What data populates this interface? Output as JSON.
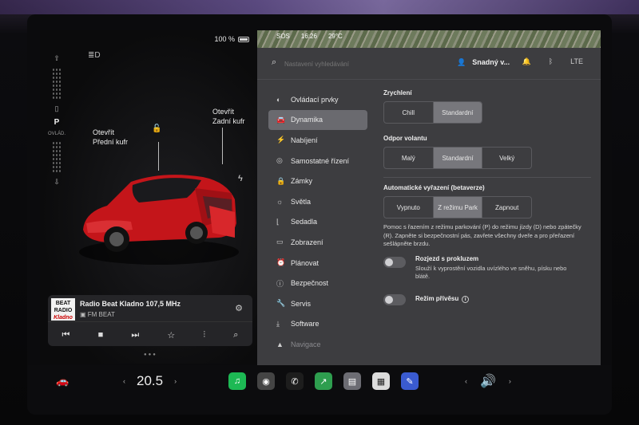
{
  "status": {
    "battery": "100 %",
    "time": "16:26",
    "temp": "29°C",
    "sos": "SOS"
  },
  "car": {
    "gear_p": "P",
    "gear_sub": "OVLÁD.",
    "front_trunk_line1": "Otevřít",
    "front_trunk_line2": "Přední kufr",
    "rear_trunk_line1": "Otevřít",
    "rear_trunk_line2": "Zadní kufr",
    "body_color": "#d0171b"
  },
  "media": {
    "logo_line1": "BEAT",
    "logo_line2": "RADIO",
    "logo_line3": "Kladno",
    "station": "Radio Beat Kladno 107,5 MHz",
    "source": "FM BEAT"
  },
  "search": {
    "placeholder": "Nastavení vyhledávání"
  },
  "profile": {
    "name": "Snadný v..."
  },
  "network": "LTE",
  "menu": [
    {
      "icon": "toggle-icon",
      "glyph": "◐",
      "label": "Ovládací prvky"
    },
    {
      "icon": "car-icon",
      "glyph": "🚘",
      "label": "Dynamika",
      "active": true
    },
    {
      "icon": "charging-icon",
      "glyph": "⚡",
      "label": "Nabíjení"
    },
    {
      "icon": "steering-wheel-icon",
      "glyph": "◎",
      "label": "Samostatné řízení"
    },
    {
      "icon": "lock-icon",
      "glyph": "🔒",
      "label": "Zámky"
    },
    {
      "icon": "light-icon",
      "glyph": "☼",
      "label": "Světla"
    },
    {
      "icon": "seat-icon",
      "glyph": "⌊",
      "label": "Sedadla"
    },
    {
      "icon": "display-icon",
      "glyph": "▭",
      "label": "Zobrazení"
    },
    {
      "icon": "alarm-clock-icon",
      "glyph": "⏰",
      "label": "Plánovat"
    },
    {
      "icon": "safety-icon",
      "glyph": "ⓘ",
      "label": "Bezpečnost"
    },
    {
      "icon": "wrench-icon",
      "glyph": "🔧",
      "label": "Servis"
    },
    {
      "icon": "download-icon",
      "glyph": "⤓",
      "label": "Software"
    },
    {
      "icon": "navigation-icon",
      "glyph": "▲",
      "label": "Navigace",
      "faded": true
    }
  ],
  "settings": {
    "acceleration": {
      "title": "Zrychlení",
      "options": [
        "Chill",
        "Standardní"
      ],
      "selected": 1
    },
    "steering": {
      "title": "Odpor volantu",
      "options": [
        "Malý",
        "Standardní",
        "Velký"
      ],
      "selected": 1
    },
    "auto_park": {
      "title": "Automatické vyřazení (betaverze)",
      "options": [
        "Vypnuto",
        "Z režimu Park",
        "Zapnout"
      ],
      "selected": 1,
      "description": "Pomoc s řazením z režimu parkování (P) do režimu jízdy (D) nebo zpátečky (R). Zapněte si bezpečnostní pás, zavřete všechny dveře a pro přeřazení sešlápněte brzdu."
    },
    "slip_start": {
      "title": "Rozjezd s prokluzem",
      "description": "Slouží k vyprostění vozidla uvízlého ve sněhu, písku nebo blátě.",
      "on": false
    },
    "trailer_mode": {
      "title": "Režim přívěsu",
      "on": false
    }
  },
  "dock": {
    "temperature": "20.5",
    "apps": [
      {
        "name": "spotify-app",
        "glyph": "♫",
        "color": "#1db954"
      },
      {
        "name": "camera-app",
        "glyph": "◉",
        "color": "#444"
      },
      {
        "name": "phone-app",
        "glyph": "✆",
        "color": "#1d1d1d"
      },
      {
        "name": "energy-app",
        "glyph": "↗",
        "color": "#2e9e4f"
      },
      {
        "name": "glovebox-app",
        "glyph": "▤",
        "color": "#6c6c73"
      },
      {
        "name": "toybox-app",
        "glyph": "▦",
        "color": "#dcdcdc"
      },
      {
        "name": "autopilot-app",
        "glyph": "✎",
        "color": "#3a5bd0"
      }
    ]
  }
}
